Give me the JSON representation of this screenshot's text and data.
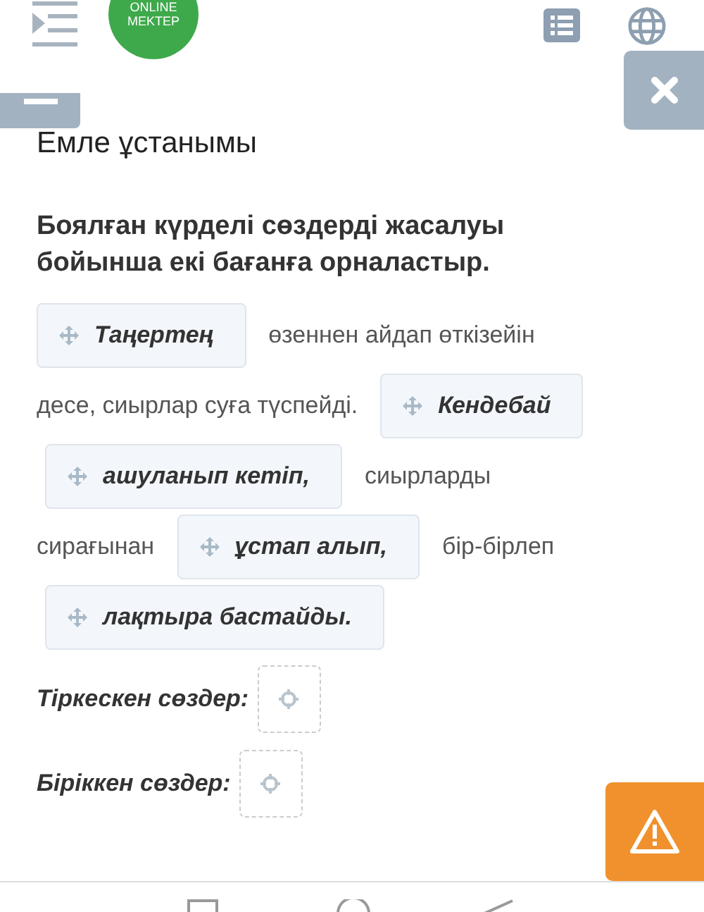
{
  "header": {
    "logo_lines": [
      "ONLINE",
      "MEKTEP"
    ]
  },
  "title": "Емле ұстанымы",
  "task": "Боялған күрделі сөздерді жасалуы бойынша екі бағанға орналастыр.",
  "lines": [
    [
      {
        "kind": "chip",
        "text": "Таңертең"
      },
      {
        "kind": "text",
        "text": "өзеннен айдап өткізейін"
      }
    ],
    [
      {
        "kind": "text",
        "text": "десе, сиырлар суға түспейді."
      },
      {
        "kind": "chip",
        "text": "Кендебай"
      }
    ],
    [
      {
        "kind": "chip",
        "text": "ашуланып кетіп,"
      },
      {
        "kind": "text",
        "text": "сиырларды"
      }
    ],
    [
      {
        "kind": "text",
        "text": "сирағынан"
      },
      {
        "kind": "chip",
        "text": "ұстап алып,"
      },
      {
        "kind": "text",
        "text": "бір-бірлеп"
      }
    ],
    [
      {
        "kind": "chip",
        "text": "лақтыра бастайды."
      }
    ]
  ],
  "targets": [
    {
      "label": "Тіркескен сөздер:"
    },
    {
      "label": "Біріккен сөздер:"
    }
  ]
}
